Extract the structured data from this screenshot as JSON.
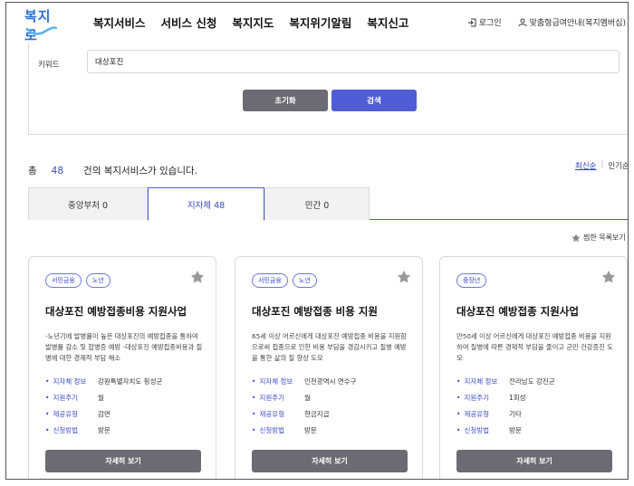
{
  "header": {
    "logo_text": "복지로",
    "nav": [
      "복지서비스",
      "서비스 신청",
      "복지지도",
      "복지위기알림",
      "복지신고"
    ],
    "login_label": "로그인",
    "guide_label": "맞춤형급여안내(복지멤버십)"
  },
  "search": {
    "keyword_label": "키워드",
    "keyword_value": "대상포진",
    "reset_label": "초기화",
    "search_label": "검색"
  },
  "results": {
    "prefix": "총",
    "count": "48",
    "suffix": "건의 복지서비스가 있습니다.",
    "sort_latest": "최신순",
    "sort_popular": "인기순"
  },
  "tabs": [
    {
      "label": "중앙부처 0"
    },
    {
      "label": "지자체 48"
    },
    {
      "label": "민간 0"
    }
  ],
  "favorites_label": "찜한 목록보기",
  "cards": [
    {
      "tags": [
        "서민금융",
        "노년"
      ],
      "title": "대상포진 예방접종비용 지원사업",
      "desc": "-노년기에 발병률이 높은 대상포진의 예방접종을 통하여 발병률 감소 및 합병증 예방 -대상포진 예방접종비용과 질병에 대한 경제적 부담 해소",
      "info": [
        {
          "key": "지자체 정보",
          "val": "강원특별자치도 횡성군"
        },
        {
          "key": "지원주기",
          "val": "월"
        },
        {
          "key": "제공유형",
          "val": "감면"
        },
        {
          "key": "신청방법",
          "val": "방문"
        }
      ],
      "button": "자세히 보기"
    },
    {
      "tags": [
        "서민금융",
        "노년"
      ],
      "title": "대상포진 예방접종 비용 지원",
      "desc": "65세 이상 어르신에게 대상포진 예방접종 비용을 지원함으로써 접종으로 인한 비용 부담을 경감시키고 질병 예방을 통한 삶의 질 향상 도모",
      "info": [
        {
          "key": "지자체 정보",
          "val": "인천광역시 연수구"
        },
        {
          "key": "지원주기",
          "val": "월"
        },
        {
          "key": "제공유형",
          "val": "현금지급"
        },
        {
          "key": "신청방법",
          "val": "방문"
        }
      ],
      "button": "자세히 보기"
    },
    {
      "tags": [
        "중장년"
      ],
      "title": "대상포진 예방접종 지원사업",
      "desc": "만50세 이상 어르신에게 대상포진 예방접종 비용을 지원하여 질병에 따른 경제적 부담을 줄이고 군민 건강증진 도모",
      "info": [
        {
          "key": "지자체 정보",
          "val": "전라남도 강진군"
        },
        {
          "key": "지원주기",
          "val": "1회성"
        },
        {
          "key": "제공유형",
          "val": "기타"
        },
        {
          "key": "신청방법",
          "val": "방문"
        }
      ],
      "button": "자세히 보기"
    }
  ],
  "colors": {
    "accent": "#4f5ed6",
    "dark_button": "#6b6b73",
    "tag_blue": "#3a48c8"
  }
}
